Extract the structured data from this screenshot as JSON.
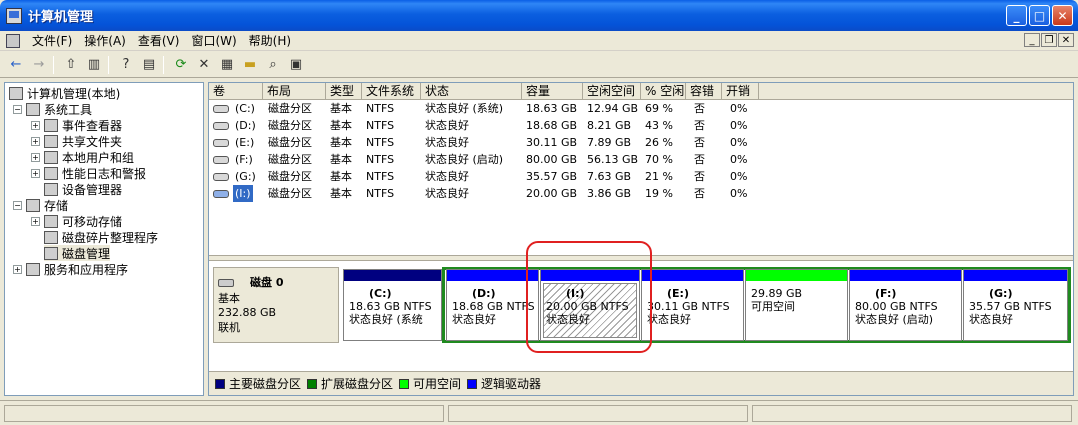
{
  "window": {
    "title": "计算机管理"
  },
  "menu": {
    "items": [
      "文件(F)",
      "操作(A)",
      "查看(V)",
      "窗口(W)",
      "帮助(H)"
    ]
  },
  "tree": {
    "items": [
      {
        "label": "计算机管理(本地)",
        "level": 0
      },
      {
        "label": "系统工具",
        "level": 1,
        "expander": "−"
      },
      {
        "label": "事件查看器",
        "level": 2,
        "expander": "+"
      },
      {
        "label": "共享文件夹",
        "level": 2,
        "expander": "+"
      },
      {
        "label": "本地用户和组",
        "level": 2,
        "expander": "+"
      },
      {
        "label": "性能日志和警报",
        "level": 2,
        "expander": "+"
      },
      {
        "label": "设备管理器",
        "level": 2
      },
      {
        "label": "存储",
        "level": 1,
        "expander": "−"
      },
      {
        "label": "可移动存储",
        "level": 2,
        "expander": "+"
      },
      {
        "label": "磁盘碎片整理程序",
        "level": 2
      },
      {
        "label": "磁盘管理",
        "level": 2,
        "selected": true
      },
      {
        "label": "服务和应用程序",
        "level": 1,
        "expander": "+"
      }
    ]
  },
  "volume_table": {
    "headers": [
      "卷",
      "布局",
      "类型",
      "文件系统",
      "状态",
      "容量",
      "空闲空间",
      "% 空闲",
      "容错",
      "开销"
    ],
    "rows": [
      [
        "(C:)",
        "磁盘分区",
        "基本",
        "NTFS",
        "状态良好 (系统)",
        "18.63 GB",
        "12.94 GB",
        "69 %",
        "否",
        "0%"
      ],
      [
        "(D:)",
        "磁盘分区",
        "基本",
        "NTFS",
        "状态良好",
        "18.68 GB",
        "8.21 GB",
        "43 %",
        "否",
        "0%"
      ],
      [
        "(E:)",
        "磁盘分区",
        "基本",
        "NTFS",
        "状态良好",
        "30.11 GB",
        "7.89 GB",
        "26 %",
        "否",
        "0%"
      ],
      [
        "(F:)",
        "磁盘分区",
        "基本",
        "NTFS",
        "状态良好 (启动)",
        "80.00 GB",
        "56.13 GB",
        "70 %",
        "否",
        "0%"
      ],
      [
        "(G:)",
        "磁盘分区",
        "基本",
        "NTFS",
        "状态良好",
        "35.57 GB",
        "7.63 GB",
        "21 %",
        "否",
        "0%"
      ],
      [
        "(I:)",
        "磁盘分区",
        "基本",
        "NTFS",
        "状态良好",
        "20.00 GB",
        "3.86 GB",
        "19 %",
        "否",
        "0%"
      ]
    ]
  },
  "disk": {
    "name": "磁盘 0",
    "type": "基本",
    "size": "232.88 GB",
    "status": "联机"
  },
  "partitions": [
    {
      "title": "(C:)",
      "size": "18.63 GB NTFS",
      "status": "状态良好 (系统",
      "bar_color": "#000080"
    },
    {
      "title": "(D:)",
      "size": "18.68 GB NTFS",
      "status": "状态良好",
      "bar_color": "#0000ff"
    },
    {
      "title": "(I:)",
      "size": "20.00 GB NTFS",
      "status": "状态良好",
      "bar_color": "#0000ff"
    },
    {
      "title": "(E:)",
      "size": "30.11 GB NTFS",
      "status": "状态良好",
      "bar_color": "#0000ff"
    },
    {
      "title": "",
      "size": "29.89 GB",
      "status": "可用空间",
      "bar_color": "#00ff00"
    },
    {
      "title": "(F:)",
      "size": "80.00 GB NTFS",
      "status": "状态良好 (启动)",
      "bar_color": "#0000ff"
    },
    {
      "title": "(G:)",
      "size": "35.57 GB NTFS",
      "status": "状态良好",
      "bar_color": "#0000ff"
    }
  ],
  "legend": [
    {
      "label": "主要磁盘分区",
      "color": "#000080"
    },
    {
      "label": "扩展磁盘分区",
      "color": "#008000"
    },
    {
      "label": "可用空间",
      "color": "#00ff00"
    },
    {
      "label": "逻辑驱动器",
      "color": "#0000ff"
    }
  ]
}
